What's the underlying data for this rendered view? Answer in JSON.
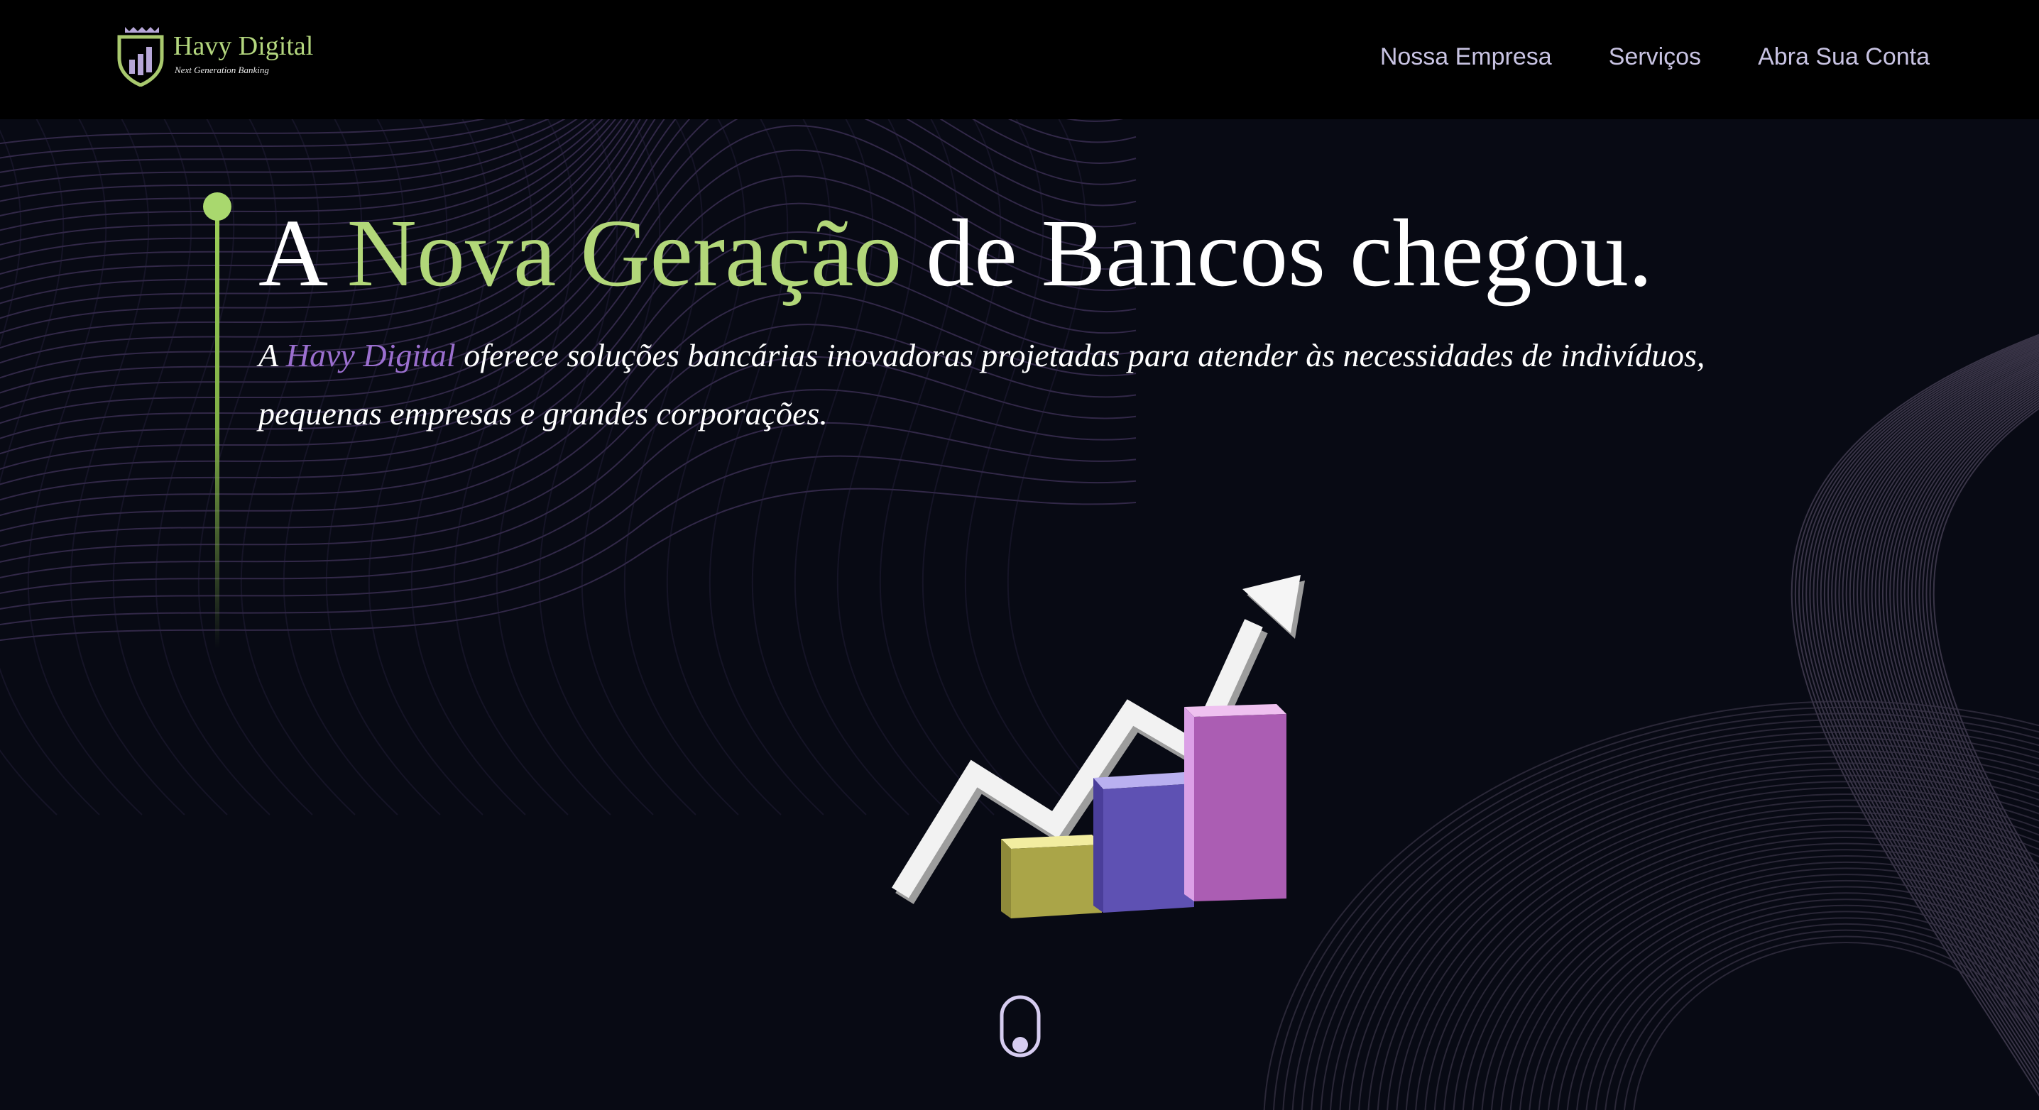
{
  "header": {
    "logo": {
      "name": "Havy Digital",
      "tagline": "Next Generation Banking",
      "emblem_icon": "shield-bar-chart-icon"
    },
    "nav": [
      {
        "label": "Nossa Empresa"
      },
      {
        "label": "Serviços"
      },
      {
        "label": "Abra Sua Conta"
      }
    ]
  },
  "hero": {
    "title_prefix": "A ",
    "title_accent": "Nova Geração",
    "title_suffix": " de Bancos chegou.",
    "subtitle_prefix": "A ",
    "subtitle_brand": "Havy Digital",
    "subtitle_suffix": " oferece soluções bancárias inovadoras projetadas para atender às necessidades de indivíduos, pequenas empresas e grandes corporações.",
    "illustration_icon": "growth-bar-chart-arrow-icon",
    "scroll_icon": "mouse-scroll-icon"
  },
  "colors": {
    "background": "#080a14",
    "header": "#000000",
    "accent_green": "#b2d779",
    "accent_purple": "#9b6fcf",
    "nav_text": "#c8c3e2"
  }
}
